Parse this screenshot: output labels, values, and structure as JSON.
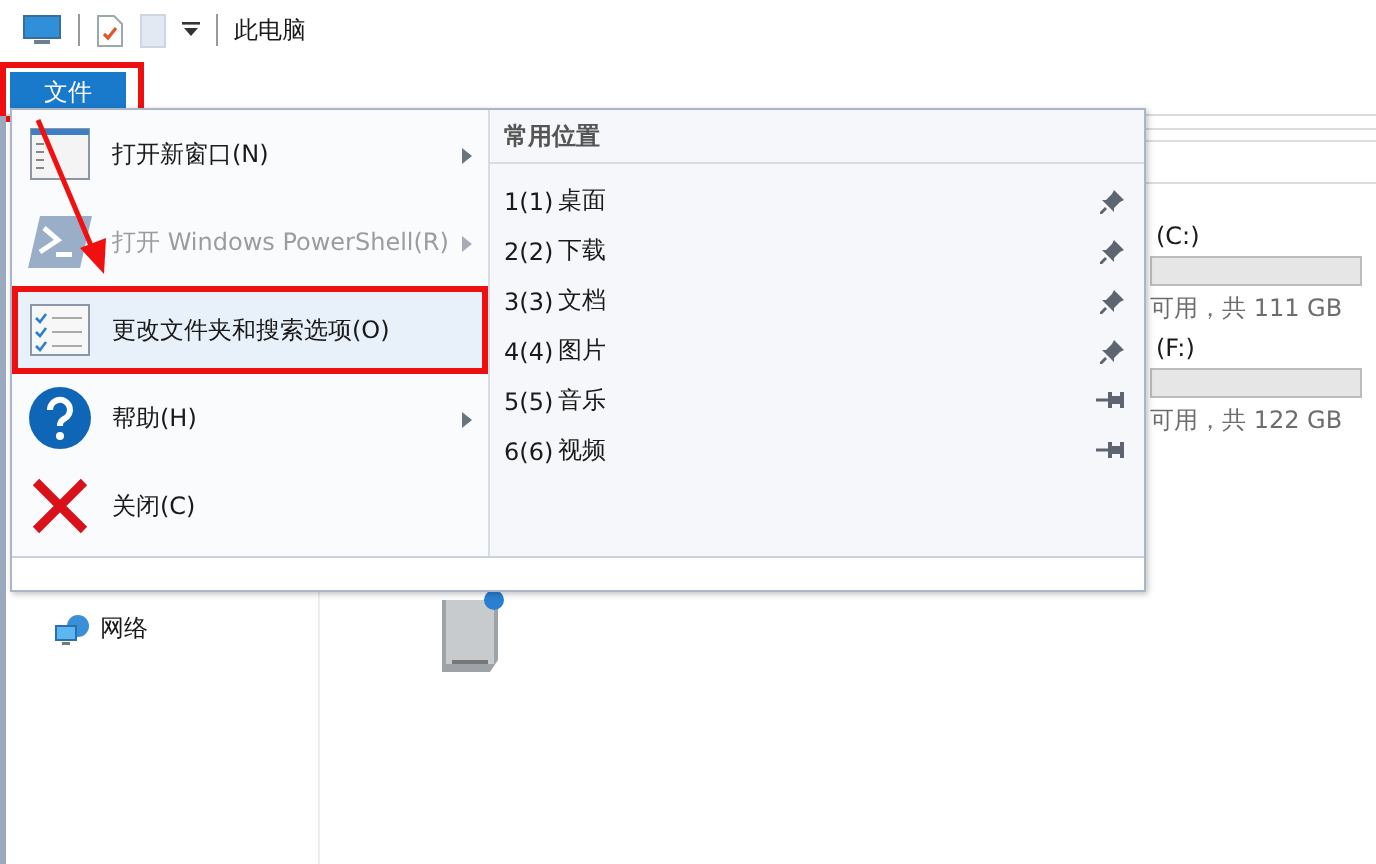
{
  "title_bar": {
    "title": "此电脑"
  },
  "ribbon": {
    "file_tab": {
      "label": "文件",
      "selected": true,
      "highlighted": true
    }
  },
  "background": {
    "drives": [
      {
        "name": "(C:)",
        "space": "可用，共 111 GB"
      },
      {
        "name": "(F:)",
        "space": "可用，共 122 GB"
      }
    ],
    "sidebar_items": [
      {
        "label": "网络"
      }
    ]
  },
  "file_menu": {
    "items": [
      {
        "kind": "window",
        "label": "打开新窗口(N)",
        "disabled": false,
        "has_submenu": true,
        "highlighted": false
      },
      {
        "kind": "powershell",
        "label": "打开 Windows PowerShell(R)",
        "disabled": true,
        "has_submenu": true,
        "highlighted": false
      },
      {
        "kind": "options",
        "label": "更改文件夹和搜索选项(O)",
        "disabled": false,
        "has_submenu": false,
        "highlighted": true
      },
      {
        "kind": "help",
        "label": "帮助(H)",
        "disabled": false,
        "has_submenu": true,
        "highlighted": false
      },
      {
        "kind": "close",
        "label": "关闭(C)",
        "disabled": false,
        "has_submenu": false,
        "highlighted": false
      }
    ],
    "frequent": {
      "title": "常用位置",
      "places": [
        {
          "key": "1(1)",
          "name": "桌面",
          "pinned": true
        },
        {
          "key": "2(2)",
          "name": "下载",
          "pinned": true
        },
        {
          "key": "3(3)",
          "name": "文档",
          "pinned": true
        },
        {
          "key": "4(4)",
          "name": "图片",
          "pinned": true
        },
        {
          "key": "5(5)",
          "name": "音乐",
          "pinned": false
        },
        {
          "key": "6(6)",
          "name": "视频",
          "pinned": false
        }
      ]
    }
  },
  "annotation_arrow": true
}
